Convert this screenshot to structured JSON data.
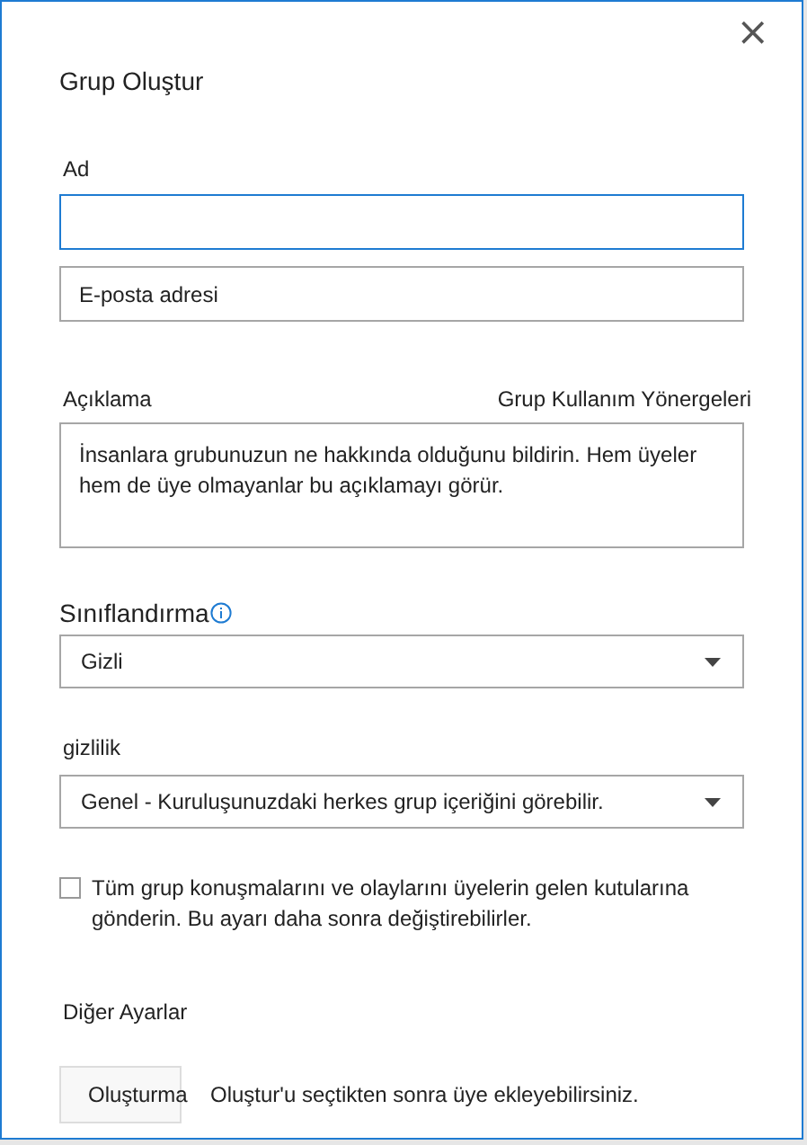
{
  "dialog": {
    "title": "Grup Oluştur",
    "close": "×"
  },
  "name": {
    "label": "Ad",
    "focused": true
  },
  "email": {
    "placeholder": "E-posta adresi",
    "focused": false
  },
  "description": {
    "label": "Açıklama",
    "link": "Grup Kullanım Yönergeleri",
    "placeholder": "İnsanlara grubunuzun ne hakkında olduğunu bildirin. Hem üyeler hem de üye olmayanlar bu açıklamayı görür."
  },
  "classification": {
    "label": "Sınıflandırma",
    "value": "Gizli"
  },
  "privacy": {
    "label": "gizlilik",
    "value": "Genel - Kuruluşunuzdaki herkes grup içeriğini görebilir."
  },
  "subscribe": {
    "label": "Tüm grup konuşmalarını ve olaylarını üyelerin gelen kutularına gönderin. Bu ayarı daha sonra değiştirebilirler.",
    "checked": false
  },
  "more_settings": "Diğer Ayarlar",
  "create_button": "Oluşturma",
  "create_hint": "Oluştur'u seçtikten sonra üye ekleyebilirsiniz."
}
